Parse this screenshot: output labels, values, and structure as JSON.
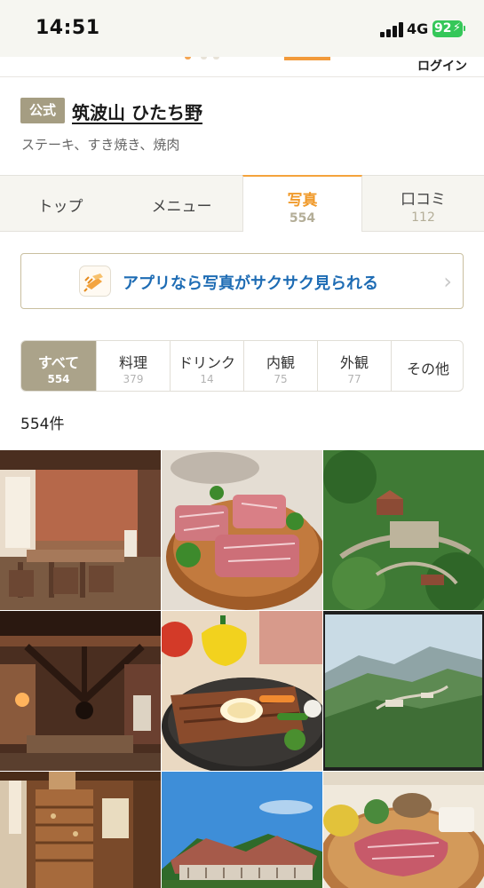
{
  "status_bar": {
    "time": "14:51",
    "network": "4G",
    "battery": "92",
    "battery_color": "#35c759"
  },
  "header": {
    "login_label": "ログイン",
    "accent_color": "#f29a3a"
  },
  "restaurant": {
    "official_badge": "公式",
    "name": "筑波山 ひたち野",
    "genre": "ステーキ、すき焼き、焼肉"
  },
  "tabs": [
    {
      "label": "トップ",
      "count": null,
      "active": false
    },
    {
      "label": "メニュー",
      "count": null,
      "active": false
    },
    {
      "label": "写真",
      "count": "554",
      "active": true
    },
    {
      "label": "口コミ",
      "count": "112",
      "active": false
    }
  ],
  "app_banner": {
    "text": "アプリなら写真がサクサク見られる",
    "icon": "app-hand-icon",
    "chevron": "chevron-right-icon",
    "text_color": "#1e6cb4"
  },
  "photo_filters": [
    {
      "label": "すべて",
      "count": "554",
      "active": true
    },
    {
      "label": "料理",
      "count": "379",
      "active": false
    },
    {
      "label": "ドリンク",
      "count": "14",
      "active": false
    },
    {
      "label": "内観",
      "count": "75",
      "active": false
    },
    {
      "label": "外観",
      "count": "77",
      "active": false
    },
    {
      "label": "その他",
      "count": null,
      "active": false
    }
  ],
  "photo_count": "554件",
  "photos": [
    {
      "subject": "interior-dining-room"
    },
    {
      "subject": "raw-wagyu-steaks"
    },
    {
      "subject": "aerial-view-hillside"
    },
    {
      "subject": "interior-hearth"
    },
    {
      "subject": "grilled-steak-plate"
    },
    {
      "subject": "mountain-landscape"
    },
    {
      "subject": "interior-wooden-chest"
    },
    {
      "subject": "exterior-building"
    },
    {
      "subject": "steak-with-vegetables"
    }
  ]
}
